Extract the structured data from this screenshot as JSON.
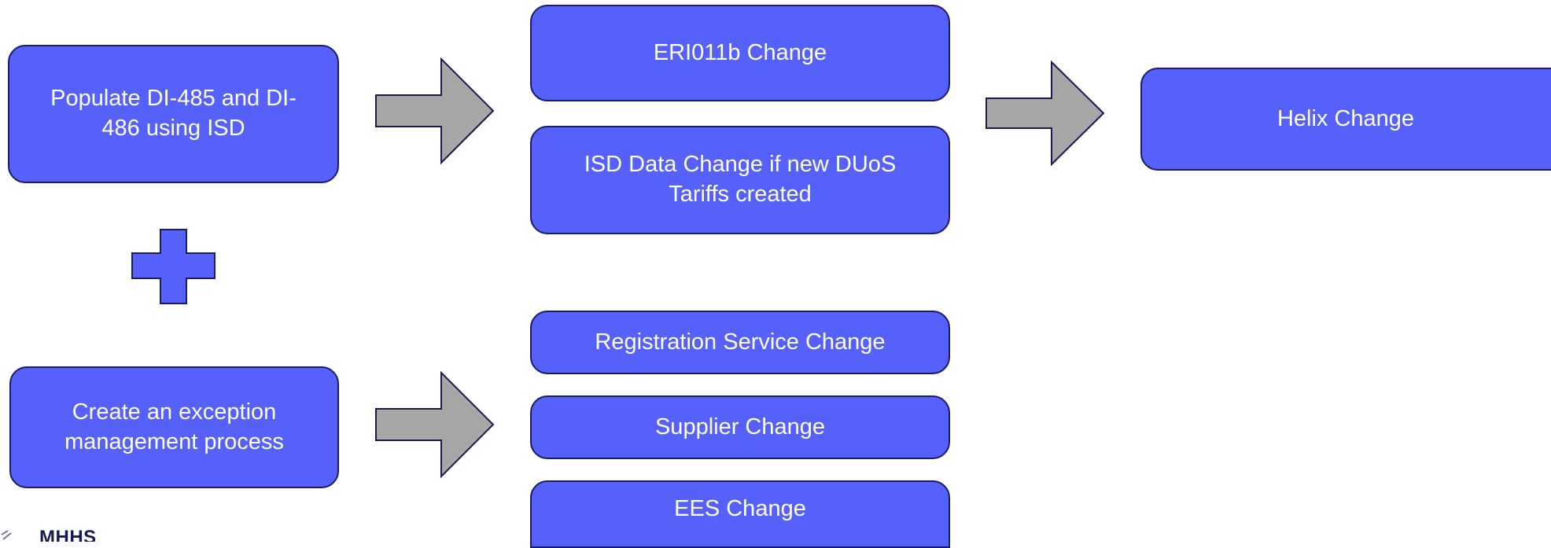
{
  "boxes": {
    "populate": "Populate DI-485 and DI-486 using ISD",
    "exception": "Create an exception management process",
    "eri011b": "ERI011b Change",
    "isd_data": "ISD Data Change if new DUoS Tariffs created",
    "helix": "Helix Change",
    "registration": "Registration Service Change",
    "supplier": "Supplier Change",
    "ees": "EES Change"
  },
  "logo": {
    "text": "MHHS"
  },
  "colors": {
    "box_fill": "#5561f9",
    "box_border": "#1a1a6e",
    "arrow_fill": "#a6a6a6",
    "arrow_border": "#1a1a4e"
  }
}
